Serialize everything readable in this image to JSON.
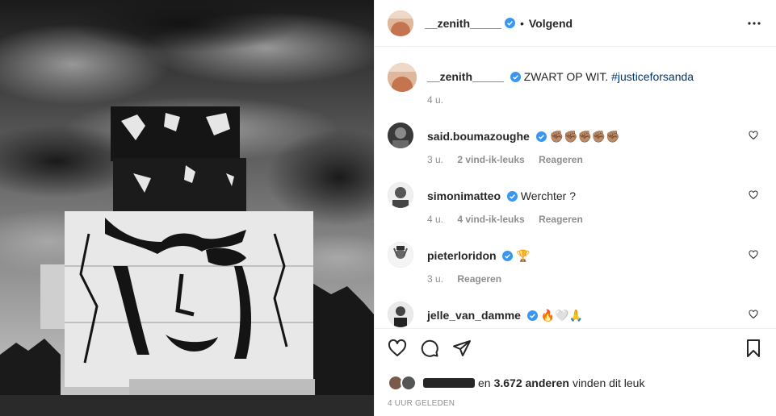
{
  "post": {
    "image_alt": "",
    "author": "__zenith_____",
    "follow_separator": "•",
    "follow_status": "Volgend",
    "more_icon": "more-horizontal-icon"
  },
  "caption": {
    "username": "__zenith_____",
    "text": "ZWART OP WIT. ",
    "hashtag": "#justiceforsanda",
    "time": "4 u."
  },
  "comments": [
    {
      "username": "said.boumazoughe",
      "text": "✊🏽✊🏽✊🏽✊🏽✊🏽",
      "time": "3 u.",
      "likes": "2 vind-ik-leuks",
      "reply": "Reageren"
    },
    {
      "username": "simonimatteo",
      "text": "Werchter ?",
      "time": "4 u.",
      "likes": "4 vind-ik-leuks",
      "reply": "Reageren"
    },
    {
      "username": "pieterloridon",
      "text": "🏆",
      "time": "3 u.",
      "likes": "",
      "reply": "Reageren"
    },
    {
      "username": "jelle_van_damme",
      "text": "🔥🤍🙏",
      "time": "",
      "likes": "",
      "reply": ""
    }
  ],
  "likes_summary": {
    "and_text": "en",
    "count": "3.672 anderen",
    "suffix": "vinden dit leuk"
  },
  "timestamp": "4 UUR GELEDEN",
  "colors": {
    "verified": "#3897f0",
    "text": "#262626",
    "muted": "#8e8e8e",
    "hashtag": "#00376b"
  }
}
